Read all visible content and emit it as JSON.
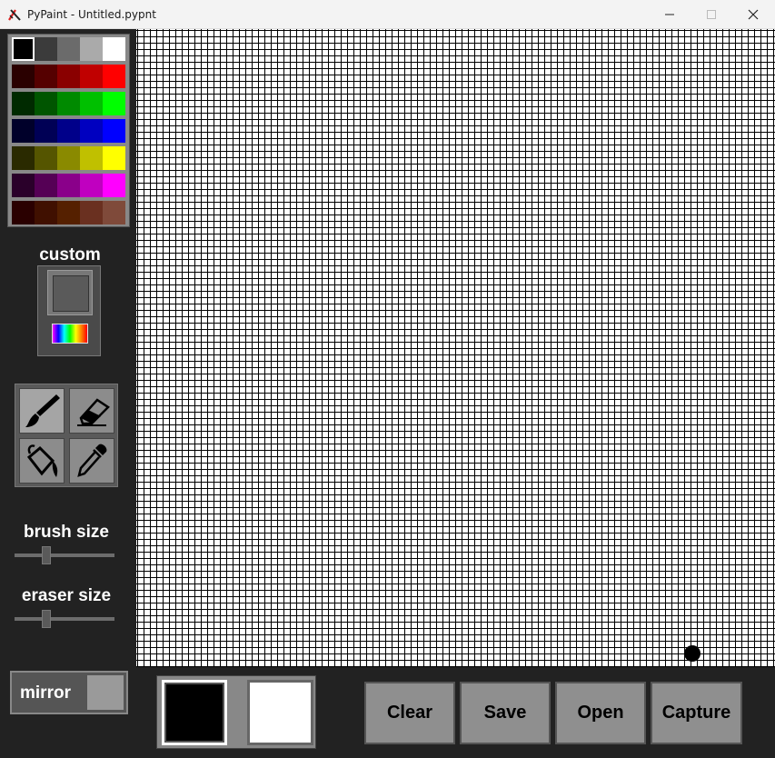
{
  "window": {
    "title": "PyPaint - Untitled.pypnt"
  },
  "palette": {
    "rows": [
      [
        "#000000",
        "#3b3b3b",
        "#6b6b6b",
        "#aaaaaa",
        "#ffffff"
      ],
      [
        "#2a0000",
        "#550000",
        "#8a0000",
        "#c00000",
        "#ff0000"
      ],
      [
        "#002a00",
        "#005500",
        "#008a00",
        "#00c000",
        "#00ff00"
      ],
      [
        "#00002a",
        "#000055",
        "#00008a",
        "#0000c0",
        "#0000ff"
      ],
      [
        "#2a2a00",
        "#555500",
        "#8a8a00",
        "#c0c000",
        "#ffff00"
      ],
      [
        "#2a002a",
        "#550055",
        "#8a008a",
        "#c000c0",
        "#ff00ff"
      ],
      [
        "#2a0000",
        "#401000",
        "#552000",
        "#6a3020",
        "#7f4a3a"
      ]
    ],
    "selected": "#000000"
  },
  "custom": {
    "label": "custom",
    "current_color": "#5a5a5a"
  },
  "tools": [
    {
      "name": "brush",
      "icon": "paintbrush-icon",
      "active": true
    },
    {
      "name": "eraser",
      "icon": "eraser-icon",
      "active": false
    },
    {
      "name": "fill",
      "icon": "paint-bucket-icon",
      "active": false
    },
    {
      "name": "eyedropper",
      "icon": "eyedropper-icon",
      "active": false
    }
  ],
  "brush_size": {
    "label": "brush size",
    "value": 0.3
  },
  "eraser_size": {
    "label": "eraser size",
    "value": 0.3
  },
  "mirror": {
    "label": "mirror",
    "enabled": false
  },
  "colors": {
    "primary": "#000000",
    "secondary": "#ffffff"
  },
  "actions": {
    "clear": "Clear",
    "save": "Save",
    "open": "Open",
    "capture": "Capture"
  }
}
